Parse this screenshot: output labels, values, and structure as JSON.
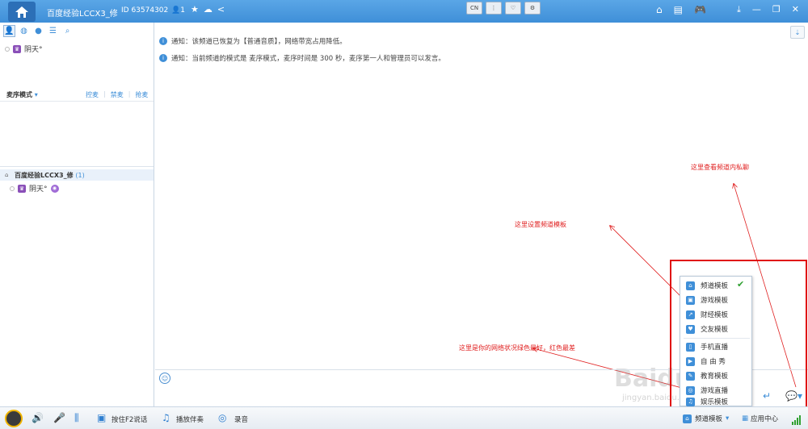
{
  "titlebar": {
    "title": "百度经验LCCX3_修",
    "id_text": "ID 63574302",
    "user_count": "1",
    "center_tools": [
      "CN",
      "⋮",
      "♡",
      "⚙"
    ]
  },
  "left_panel": {
    "top_user": "阴天°",
    "mode_label": "麦序模式",
    "mode_links": [
      "控麦",
      "禁麦",
      "抢麦"
    ],
    "channel": {
      "name": "百度经验LCCX3_修",
      "count": "(1)"
    },
    "member": "阴天°"
  },
  "notices": [
    "通知：该频道已恢复为【普通音质】，网络带宽占用降低。",
    "通知：当前频道的模式是 麦序模式，麦序时间是 300 秒，麦序第一人和管理员可以发言。"
  ],
  "annotations": {
    "private_msg": "这里查看频道内私聊",
    "template": "这里设置频道模板",
    "network": "这里是你的网络状况绿色最好，红色最差"
  },
  "template_menu": [
    {
      "label": "频道模板",
      "icon": "home-icon",
      "checked": true
    },
    {
      "label": "游戏模板",
      "icon": "game-icon",
      "checked": false
    },
    {
      "label": "财经模板",
      "icon": "chart-icon",
      "checked": false
    },
    {
      "label": "交友模板",
      "icon": "heart-icon",
      "checked": false
    },
    {
      "label": "手机直播",
      "icon": "mobile-icon",
      "checked": false
    },
    {
      "label": "自 由 秀",
      "icon": "show-icon",
      "checked": false
    },
    {
      "label": "教育模板",
      "icon": "edu-icon",
      "checked": false
    },
    {
      "label": "游戏直播",
      "icon": "live-icon",
      "checked": false
    },
    {
      "label": "娱乐模板",
      "icon": "music-icon",
      "checked": false
    }
  ],
  "bottom_bar": {
    "f2_label": "按住F2说话",
    "music_label": "播放伴奏",
    "record_label": "录音",
    "template_label": "频道模板",
    "app_center_label": "应用中心"
  },
  "watermark": {
    "main": "Baidu经验",
    "sub": "jingyan.baidu.com"
  },
  "colors": {
    "accent": "#3f8fd8",
    "annotation": "#e02020",
    "signal": "#2fa030"
  }
}
